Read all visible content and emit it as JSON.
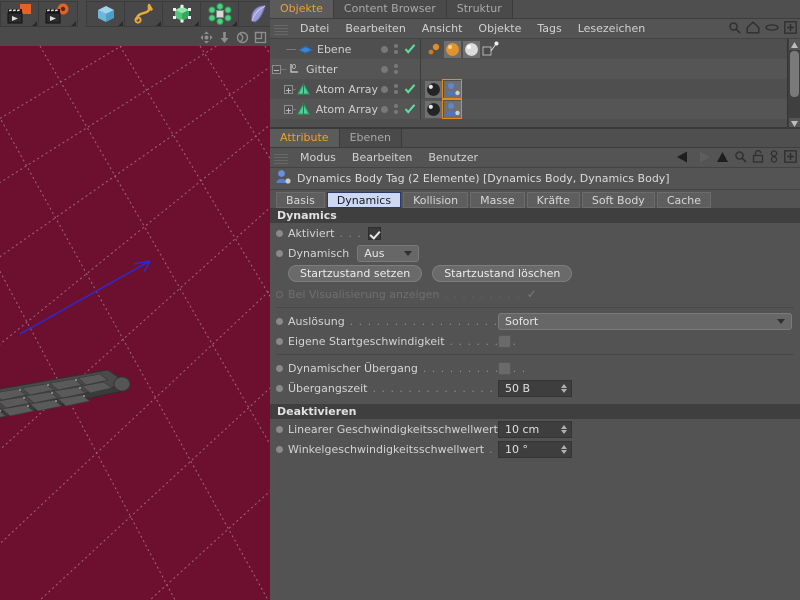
{
  "toolbar": {
    "groups": [
      {
        "name": "render-group",
        "buttons": [
          {
            "icon": "render-view-icon",
            "label": "Im Ansichtsfenster rendern"
          },
          {
            "icon": "render-settings-icon",
            "label": "Rendervoreinstellungen"
          }
        ]
      },
      {
        "name": "object-group",
        "buttons": [
          {
            "icon": "cube-primitive-icon",
            "label": "Grundobjekte"
          },
          {
            "icon": "spline-icon",
            "label": "Spline-Objekte"
          },
          {
            "icon": "generator-icon",
            "label": "NURBS-Objekte"
          },
          {
            "icon": "array-icon",
            "label": "Modeling-Objekte"
          },
          {
            "icon": "bend-deformer-icon",
            "label": "Deformations-Objekte"
          },
          {
            "icon": "scene-icon",
            "label": "Szene-Objekte"
          }
        ]
      }
    ]
  },
  "viewport": {
    "nav_icons": [
      {
        "icon": "move-camera-icon",
        "label": "Kamera verschieben"
      },
      {
        "icon": "zoom-camera-icon",
        "label": "Kamera zoomen"
      },
      {
        "icon": "rotate-camera-icon",
        "label": "Kamera drehen"
      },
      {
        "icon": "maximize-view-icon",
        "label": "Ansicht maximieren"
      }
    ],
    "background_color": "#6d1030",
    "grid_color": "#9d6b80",
    "axis_color": "#2a2ad0"
  },
  "object_manager": {
    "tabs": [
      {
        "label": "Objekte",
        "active": true
      },
      {
        "label": "Content Browser",
        "active": false
      },
      {
        "label": "Struktur",
        "active": false
      }
    ],
    "menus": [
      "Datei",
      "Bearbeiten",
      "Ansicht",
      "Objekte",
      "Tags",
      "Lesezeichen"
    ],
    "header_icons": [
      {
        "icon": "search-icon"
      },
      {
        "icon": "home-icon"
      },
      {
        "icon": "lens-icon"
      },
      {
        "icon": "plus-box-icon"
      }
    ],
    "rows": [
      {
        "name": "Ebene",
        "object_icon": "plane-object-icon",
        "depth": 1,
        "expander": "none",
        "enabled_tick": true,
        "tags": [
          {
            "icon": "material-small-icon",
            "selected": false
          },
          {
            "icon": "material-orange-icon",
            "selected": false
          },
          {
            "icon": "material-white-icon",
            "selected": false
          },
          {
            "icon": "connector-tag-icon",
            "selected": false
          }
        ]
      },
      {
        "name": "Gitter",
        "object_icon": "null-object-icon",
        "depth": 0,
        "expander": "minus",
        "enabled_tick": false,
        "tags": []
      },
      {
        "name": "Atom Array",
        "object_icon": "atom-array-icon",
        "depth": 1,
        "expander": "plus",
        "enabled_tick": true,
        "tags": [
          {
            "icon": "material-dark-icon",
            "selected": false
          },
          {
            "icon": "dynamics-body-tag-icon",
            "selected": true
          }
        ]
      },
      {
        "name": "Atom Array",
        "object_icon": "atom-array-icon",
        "depth": 1,
        "expander": "plus",
        "enabled_tick": true,
        "tags": [
          {
            "icon": "material-dark-icon",
            "selected": false
          },
          {
            "icon": "dynamics-body-tag-icon",
            "selected": true
          }
        ]
      }
    ]
  },
  "attribute_manager": {
    "tabs": [
      {
        "label": "Attribute",
        "active": true
      },
      {
        "label": "Ebenen",
        "active": false
      }
    ],
    "menus": [
      "Modus",
      "Bearbeiten",
      "Benutzer"
    ],
    "header_icons": [
      {
        "icon": "back-arrow-icon"
      },
      {
        "icon": "forward-arrow-icon"
      },
      {
        "icon": "up-arrow-icon"
      },
      {
        "icon": "search-icon"
      },
      {
        "icon": "unlock-icon"
      },
      {
        "icon": "chain-link-icon"
      },
      {
        "icon": "plus-box-icon"
      }
    ],
    "selection_title": "Dynamics Body Tag (2 Elemente) [Dynamics Body, Dynamics Body]",
    "selection_icon": "dynamics-body-tag-icon",
    "param_tabs": [
      {
        "label": "Basis",
        "active": false
      },
      {
        "label": "Dynamics",
        "active": true
      },
      {
        "label": "Kollision",
        "active": false
      },
      {
        "label": "Masse",
        "active": false
      },
      {
        "label": "Kräfte",
        "active": false
      },
      {
        "label": "Soft Body",
        "active": false
      },
      {
        "label": "Cache",
        "active": false
      }
    ],
    "sections": [
      {
        "title": "Dynamics",
        "rows": [
          {
            "kind": "checkbox",
            "label": "Aktiviert",
            "dots": ". . .",
            "value": true,
            "dim": false
          },
          {
            "kind": "select",
            "label": "Dynamisch",
            "dots": "",
            "value": "Aus",
            "dim": false
          },
          {
            "kind": "buttons",
            "buttons": [
              "Startzustand setzen",
              "Startzustand löschen"
            ]
          },
          {
            "kind": "tick",
            "label": "Bei Visualisierung anzeigen",
            "dots": ". . . . . . . . .",
            "value": true,
            "dim": true
          },
          {
            "kind": "divider"
          },
          {
            "kind": "select-wide",
            "label": "Auslösung",
            "dots": ". . . . . . . . . . . . . . . . .",
            "value": "Sofort",
            "dim": false
          },
          {
            "kind": "toggle",
            "label": "Eigene Startgeschwindigkeit",
            "dots": ". . . . . . . .",
            "value": false,
            "dim": false
          },
          {
            "kind": "divider"
          },
          {
            "kind": "toggle",
            "label": "Dynamischer Übergang",
            "dots": ". . . . . . . . . . . .",
            "value": false,
            "dim": false
          },
          {
            "kind": "number",
            "label": "Übergangszeit",
            "dots": ". . . . . . . . . . . . . . . .",
            "value": "50 B",
            "dim": false
          }
        ]
      },
      {
        "title": "Deaktivieren",
        "rows": [
          {
            "kind": "number",
            "label": "Linearer Geschwindigkeitsschwellwert",
            "dots": "",
            "value": "10 cm",
            "dim": false
          },
          {
            "kind": "number",
            "label": "Winkelgeschwindigkeitsschwellwert",
            "dots": " .",
            "value": "10 °",
            "dim": false
          }
        ]
      }
    ]
  }
}
